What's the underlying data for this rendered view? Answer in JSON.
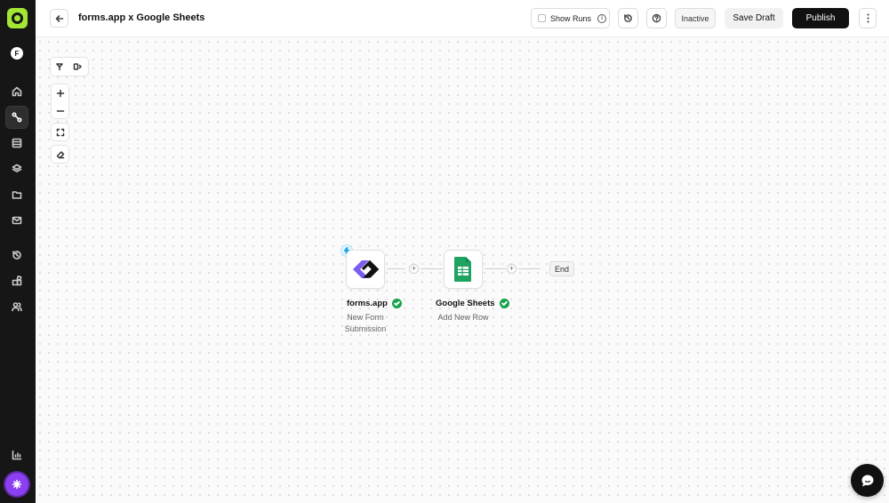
{
  "header": {
    "flow_title": "forms.app x Google Sheets",
    "show_runs_label": "Show Runs",
    "status_label": "Inactive",
    "save_draft_label": "Save Draft",
    "publish_label": "Publish"
  },
  "user": {
    "avatar_initial": "F"
  },
  "sidebar": {
    "items": [
      {
        "icon": "home-icon"
      },
      {
        "icon": "flows-icon",
        "active": true
      },
      {
        "icon": "tables-icon"
      },
      {
        "icon": "layers-icon"
      },
      {
        "icon": "folder-icon"
      },
      {
        "icon": "mail-icon"
      },
      {
        "icon": "history-icon"
      },
      {
        "icon": "apps-icon"
      },
      {
        "icon": "users-icon"
      },
      {
        "icon": "analytics-icon"
      }
    ]
  },
  "flow": {
    "trigger": {
      "title": "forms.app",
      "subtitle": "New Form Submission",
      "status": "valid"
    },
    "action": {
      "title": "Google Sheets",
      "subtitle": "Add New Row",
      "status": "valid"
    },
    "end_label": "End"
  },
  "colors": {
    "accent": "#a3e635",
    "ai_button": "#8b3ff0",
    "success": "#16a34a",
    "forms_app_purple": "#7c5cf0",
    "sheets_green": "#1ea362"
  }
}
